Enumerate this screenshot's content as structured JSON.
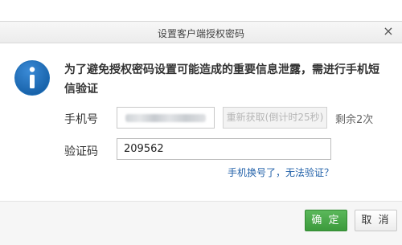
{
  "dialog": {
    "title": "设置客户端授权密码",
    "close_glyph": "×"
  },
  "message": {
    "icon": "info-icon",
    "text": "为了避免授权密码设置可能造成的重要信息泄露，需进行手机短信验证"
  },
  "form": {
    "phone_label": "手机号",
    "phone_value_masked": true,
    "resend_button": "重新获取(倒计时25秒)",
    "remaining": "剩余2次",
    "code_label": "验证码",
    "code_value": "209562",
    "help_link": "手机换号了，无法验证？"
  },
  "footer": {
    "ok_label": "确 定",
    "cancel_label": "取 消"
  },
  "colors": {
    "accent_green": "#4cad4c",
    "info_blue": "#1f6fb8",
    "link_blue": "#1f5fa8"
  }
}
